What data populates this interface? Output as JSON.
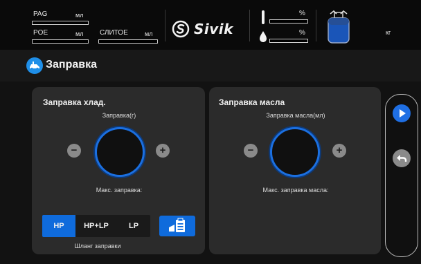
{
  "header": {
    "pag_label": "PAG",
    "pag_unit": "мл",
    "poe_label": "POE",
    "poe_unit": "мл",
    "drain_label": "СЛИТОЕ",
    "drain_unit": "мл",
    "logo_text": "Sivik",
    "pct_top": "%",
    "pct_bottom": "%",
    "tank_unit": "кг"
  },
  "page_title": "Заправка",
  "refrigerant": {
    "title": "Заправка хлад.",
    "amount_label": "Заправка(г)",
    "max_label": "Макс. заправка:",
    "hose_options": [
      "HP",
      "HP+LP",
      "LP"
    ],
    "hose_selected": "HP",
    "hose_caption": "Шланг заправки"
  },
  "oil": {
    "title": "Заправка масла",
    "amount_label": "Заправка масла(мл)",
    "max_label": "Макс. заправка масла:"
  },
  "colors": {
    "accent": "#0f6bdc",
    "panel": "#2b2b2b",
    "ring": "#1b6fe0"
  },
  "icons": {
    "title_icon": "car-service-icon",
    "play": "play-icon",
    "back": "back-arrow-icon"
  }
}
